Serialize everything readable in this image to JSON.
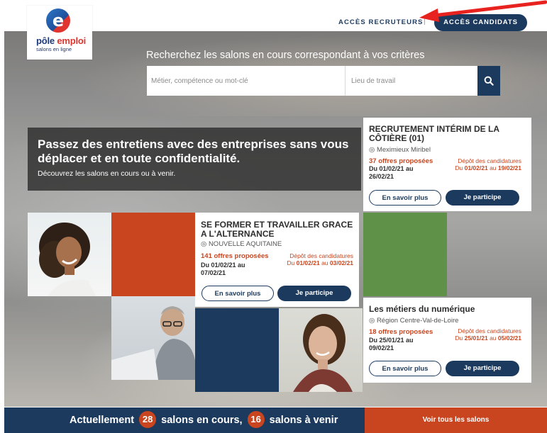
{
  "brand": {
    "logo_letter": "e",
    "name_part1": "pôle ",
    "name_part2": "emploi",
    "subtitle": "salons en ligne"
  },
  "nav": {
    "recruiters": "ACCÈS RECRUTEURS",
    "separator": "|",
    "candidates": "ACCÈS CANDIDATS"
  },
  "search": {
    "title": "Recherchez les salons en cours correspondant à vos critères",
    "keyword_placeholder": "Métier, compétence ou mot-clé",
    "location_placeholder": "Lieu de travail"
  },
  "promo": {
    "headline": "Passez des entretiens avec des entreprises sans vous déplacer et en toute confidentialité.",
    "subline": "Découvrez les salons en cours ou à venir."
  },
  "fairs": [
    {
      "title": "RECRUTEMENT INTÉRIM DE LA CÔTIÈRE (01)",
      "place": "Meximieux Miribel",
      "offers": "37 offres proposées",
      "date_line1": "Du 01/02/21 au",
      "date_line2": "26/02/21",
      "deposit_label": "Dépôt des candidatures",
      "deposit_from": "01/02/21",
      "deposit_to": "19/02/21",
      "learn_more": "En savoir plus",
      "participate": "Je participe"
    },
    {
      "title": "SE FORMER ET TRAVAILLER GRACE A L'ALTERNANCE",
      "place": "NOUVELLE AQUITAINE",
      "offers": "141 offres proposées",
      "date_line1": "Du 01/02/21 au",
      "date_line2": "07/02/21",
      "deposit_label": "Dépôt des candidatures",
      "deposit_from": "01/02/21",
      "deposit_to": "03/02/21",
      "learn_more": "En savoir plus",
      "participate": "Je participe"
    },
    {
      "title": "Les métiers du numérique",
      "place": "Région Centre-Val-de-Loire",
      "offers": "18 offres proposées",
      "date_line1": "Du 25/01/21 au",
      "date_line2": "09/02/21",
      "deposit_label": "Dépôt des candidatures",
      "deposit_from": "25/01/21",
      "deposit_to": "05/02/21",
      "learn_more": "En savoir plus",
      "participate": "Je participe"
    }
  ],
  "deposit_words": {
    "from": "Du",
    "to": "au"
  },
  "footer": {
    "prefix": "Actuellement",
    "current_count": "28",
    "middle": "salons en cours,",
    "upcoming_count": "16",
    "suffix": "salons à venir",
    "cta": "Voir tous les salons"
  },
  "colors": {
    "navy": "#1c3a5e",
    "orange": "#c8451f",
    "green": "#5f9148",
    "annotation_arrow": "#e8231f"
  },
  "icons": [
    "search-icon",
    "location-pin-icon",
    "red-arrow-annotation"
  ]
}
